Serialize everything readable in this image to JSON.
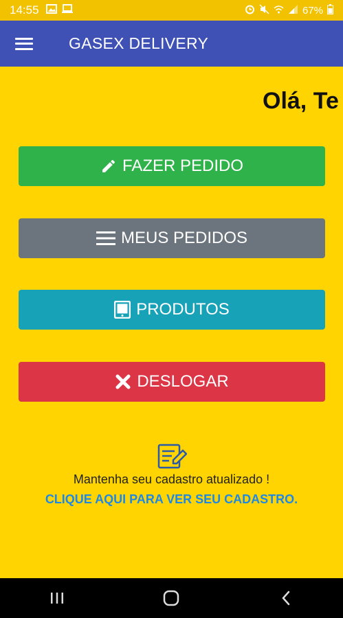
{
  "status_bar": {
    "time": "14:55",
    "battery": "67%",
    "icons": [
      "image-icon",
      "laptop-icon",
      "alarm-icon",
      "mute-icon",
      "wifi-icon",
      "signal-icon",
      "battery-icon"
    ]
  },
  "app_bar": {
    "title": "GASEX DELIVERY",
    "menu_icon": "hamburger-menu-icon"
  },
  "greeting": "Olá, Te",
  "buttons": [
    {
      "label": "FAZER PEDIDO",
      "icon": "pencil-icon",
      "color": "#2FB24A"
    },
    {
      "label": "MEUS PEDIDOS",
      "icon": "list-icon",
      "color": "#6C757D"
    },
    {
      "label": "PRODUTOS",
      "icon": "tablet-icon",
      "color": "#17A2B8"
    },
    {
      "label": "DESLOGAR",
      "icon": "close-icon",
      "color": "#DC3545"
    }
  ],
  "profile_note": {
    "icon": "edit-document-icon",
    "text": "Mantenha seu cadastro atualizado !",
    "link": "CLIQUE AQUI PARA VER SEU CADASTRO."
  },
  "nav_bar": {
    "icons": [
      "recent-apps-icon",
      "home-icon",
      "back-icon"
    ]
  },
  "colors": {
    "background": "#FFD400",
    "app_bar": "#3F51B5",
    "link": "#1E88E5"
  }
}
